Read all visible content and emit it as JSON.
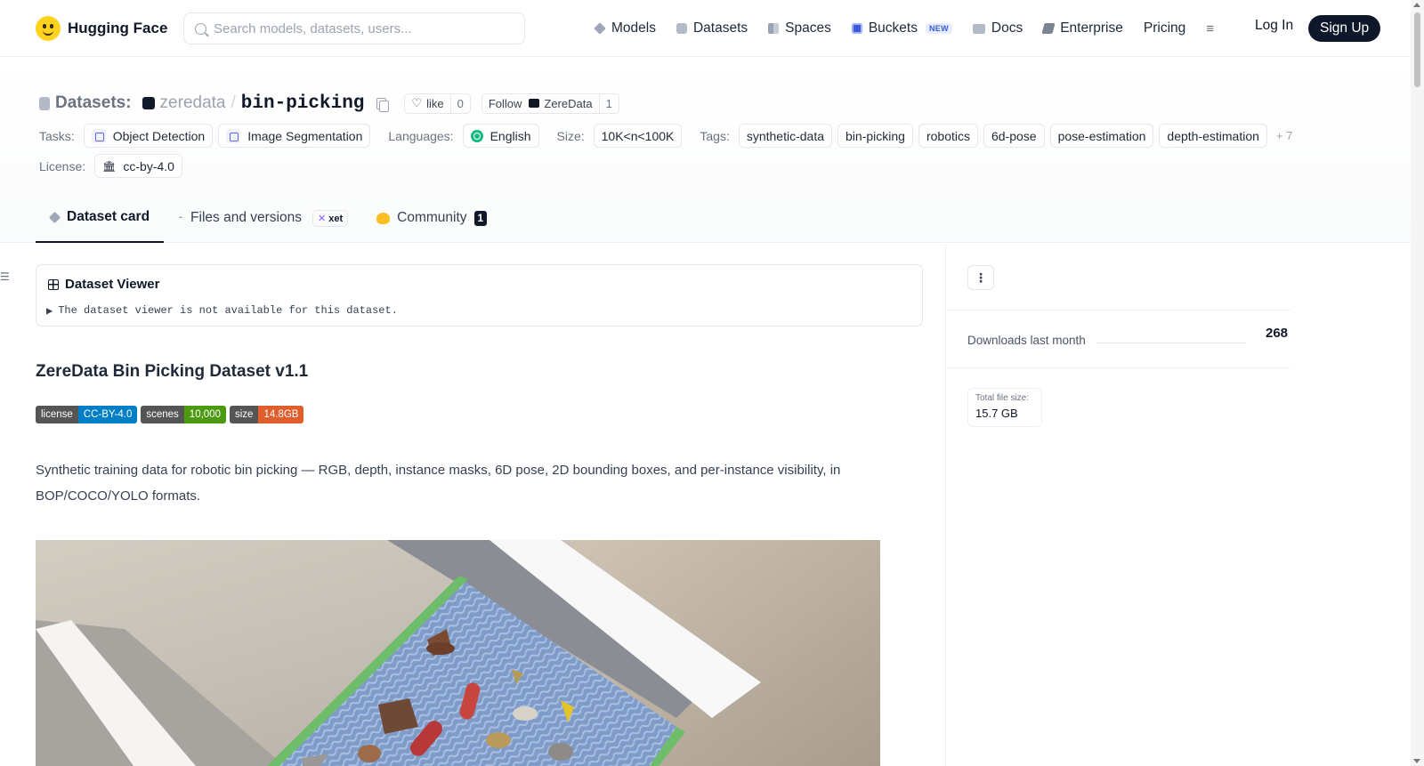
{
  "nav": {
    "brand": "Hugging Face",
    "search_placeholder": "Search models, datasets, users...",
    "links": [
      {
        "label": "Models",
        "icon": "cube-icon"
      },
      {
        "label": "Datasets",
        "icon": "database-icon"
      },
      {
        "label": "Spaces",
        "icon": "spaces-icon"
      },
      {
        "label": "Buckets",
        "icon": "bucket-icon",
        "badge": "NEW"
      },
      {
        "label": "Docs",
        "icon": "book-icon"
      },
      {
        "label": "Enterprise",
        "icon": "enterprise-icon"
      },
      {
        "label": "Pricing"
      }
    ],
    "more_icon": "≡",
    "login": "Log In",
    "signup": "Sign Up"
  },
  "repo": {
    "type_label": "Datasets:",
    "org": "zeredata",
    "separator": "/",
    "name": "bin-picking",
    "like_label": "like",
    "like_count": "0",
    "follow_label": "Follow",
    "follow_org": "ZereData",
    "follow_count": "1"
  },
  "meta": {
    "tasks_label": "Tasks:",
    "tasks": [
      "Object Detection",
      "Image Segmentation"
    ],
    "languages_label": "Languages:",
    "language": "English",
    "size_label": "Size:",
    "size": "10K<n<100K",
    "tags_label": "Tags:",
    "tags": [
      "synthetic-data",
      "bin-picking",
      "robotics",
      "6d-pose",
      "pose-estimation",
      "depth-estimation"
    ],
    "more_tags": "+ 7",
    "license_label": "License:",
    "license": "cc-by-4.0"
  },
  "tabs": {
    "card": "Dataset card",
    "files": "Files and versions",
    "xet": "xet",
    "community": "Community",
    "community_count": "1"
  },
  "viewer": {
    "title": "Dataset Viewer",
    "message": "The dataset viewer is not available for this dataset."
  },
  "card": {
    "title": "ZereData Bin Picking Dataset v1.1",
    "badges": [
      {
        "key": "license",
        "value": "CC-BY-4.0",
        "color": "#007ec6"
      },
      {
        "key": "scenes",
        "value": "10,000",
        "color": "#4c9a10"
      },
      {
        "key": "size",
        "value": "14.8GB",
        "color": "#e05d2c"
      }
    ],
    "description": "Synthetic training data for robotic bin picking — RGB, depth, instance masks, 6D pose, 2D bounding boxes, and per-instance visibility, in BOP/COCO/YOLO formats."
  },
  "sidebar": {
    "downloads_label": "Downloads last month",
    "downloads_count": "268",
    "file_size_label": "Total file size:",
    "file_size": "15.7 GB"
  },
  "colors": {
    "accent": "#111827",
    "signup_bg": "#0f172a",
    "buckets_new": "#3b5bdb"
  }
}
